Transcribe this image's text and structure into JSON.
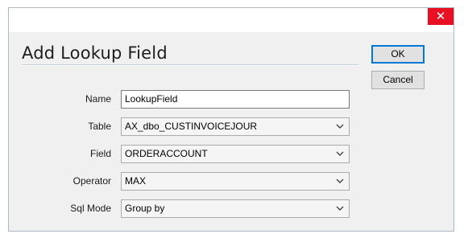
{
  "window": {
    "close_glyph": "✕"
  },
  "dialog": {
    "title": "Add Lookup Field"
  },
  "buttons": {
    "ok": "OK",
    "cancel": "Cancel"
  },
  "form": {
    "name": {
      "label": "Name",
      "value": "LookupField"
    },
    "table": {
      "label": "Table",
      "value": "AX_dbo_CUSTINVOICEJOUR"
    },
    "field": {
      "label": "Field",
      "value": "ORDERACCOUNT"
    },
    "operator": {
      "label": "Operator",
      "value": "MAX"
    },
    "sql_mode": {
      "label": "Sql Mode",
      "value": "Group by"
    }
  },
  "colors": {
    "close_button": "#e81123",
    "ok_focus_border": "#0078d7",
    "dialog_bg": "#f0f0f0"
  },
  "icons": {
    "close": "close-icon",
    "dropdown": "chevron-down-icon"
  }
}
